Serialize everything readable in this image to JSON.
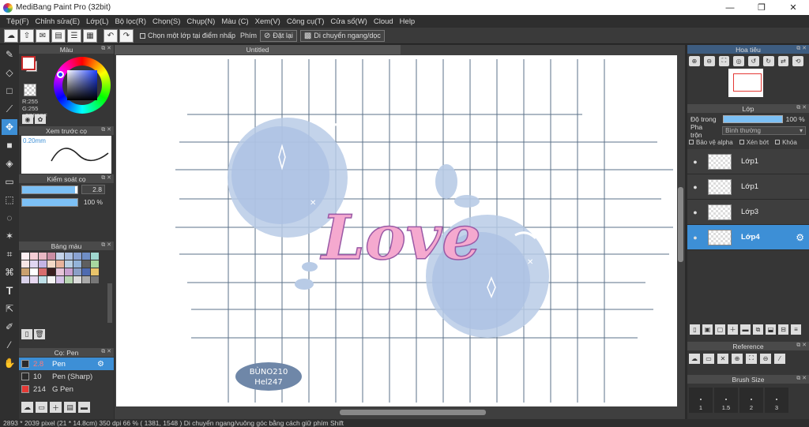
{
  "window": {
    "title": "MediBang Paint Pro (32bit)",
    "min": "—",
    "max": "❐",
    "close": "✕"
  },
  "menu": [
    "Tệp(F)",
    "Chỉnh sửa(E)",
    "Lớp(L)",
    "Bộ lọc(R)",
    "Chọn(S)",
    "Chụp(N)",
    "Màu (C)",
    "Xem(V)",
    "Công cụ(T)",
    "Cửa sổ(W)",
    "Cloud",
    "Help"
  ],
  "toolbar": {
    "check_label": "Chọn một lớp tại điểm nhấp",
    "phim_label": "Phím",
    "reset_label": "Đặt lại",
    "move_label": "Di chuyển ngang/dọc"
  },
  "color_panel": {
    "title": "Màu",
    "r": "R:255",
    "g": "G:255",
    "hex": "#FFFFFF"
  },
  "preview_panel": {
    "title": "Xem trước cọ",
    "size": "0.20mm"
  },
  "brush_control": {
    "title": "Kiểm soát cọ",
    "size_value": "2.8",
    "size_fill": 0.95,
    "opacity_value": "100 %",
    "opacity_fill": 1.0
  },
  "palette": {
    "title": "Bảng màu",
    "colors": [
      "#fdeff2",
      "#f5cdd5",
      "#e8b8c4",
      "#c98da3",
      "#c5d3ea",
      "#a9bde0",
      "#8aa2d2",
      "#6f8ec6",
      "#9fd6cf",
      "#f6e5e5",
      "#e0d6f2",
      "#c4b4e4",
      "#f3d9c6",
      "#e7b39c",
      "#b9cfe3",
      "#93b3d8",
      "#5f5f5f",
      "#a8d8a0",
      "#c9a06e",
      "#ffffff",
      "#d86d6d",
      "#3a1f1f",
      "#e6c4d8",
      "#c8a0cf",
      "#8a9fc7",
      "#4f6bb0",
      "#e9c46a",
      "#d9d2e9",
      "#e7d8f0",
      "#bfe0e8",
      "#f5f5f5",
      "#d5c2e8",
      "#b7d5b2",
      "#dcdcdc",
      "#aaaaaa",
      "#777777"
    ]
  },
  "brush_panel": {
    "title": "Cọ: Pen",
    "items": [
      {
        "size": "2.8",
        "name": "Pen",
        "color": "#2b2b2b"
      },
      {
        "size": "10",
        "name": "Pen (Sharp)",
        "color": "#2b2b2b"
      },
      {
        "size": "214",
        "name": "G Pen",
        "color": "#e53935"
      }
    ]
  },
  "canvas": {
    "tab_title": "Untitled",
    "handwriting": "Love",
    "signature_line1": "BÙNO210",
    "signature_line2": "Hel247"
  },
  "navigator": {
    "title": "Hoa tiêu"
  },
  "layer_panel": {
    "title": "Lớp",
    "opacity_label": "Độ trong",
    "opacity_value": "100 %",
    "blend_label": "Pha trộn",
    "blend_value": "Bình thường",
    "lock_alpha": "Bảo vệ alpha",
    "clip": "Xén bớt",
    "lock": "Khóa",
    "layers": [
      "Lớp1",
      "Lớp1",
      "Lớp3",
      "Lớp4"
    ],
    "active_index": 3
  },
  "reference_panel": {
    "title": "Reference"
  },
  "brushsize_panel": {
    "title": "Brush Size",
    "sizes": [
      "1",
      "1.5",
      "2",
      "3"
    ]
  },
  "status": {
    "text": "2893 * 2039 pixel   (21 * 14.8cm)   350 dpi   66 %   ( 1381, 1548 )   Di chuyển ngang/vuông góc bằng cách giữ phím Shift"
  },
  "colors": {
    "accent": "#3d8fd6",
    "bubble": "#b8cbe6",
    "bubble_dark": "#a7bde0",
    "love_pink": "#f5a9cf",
    "grid": "#5b7088"
  }
}
